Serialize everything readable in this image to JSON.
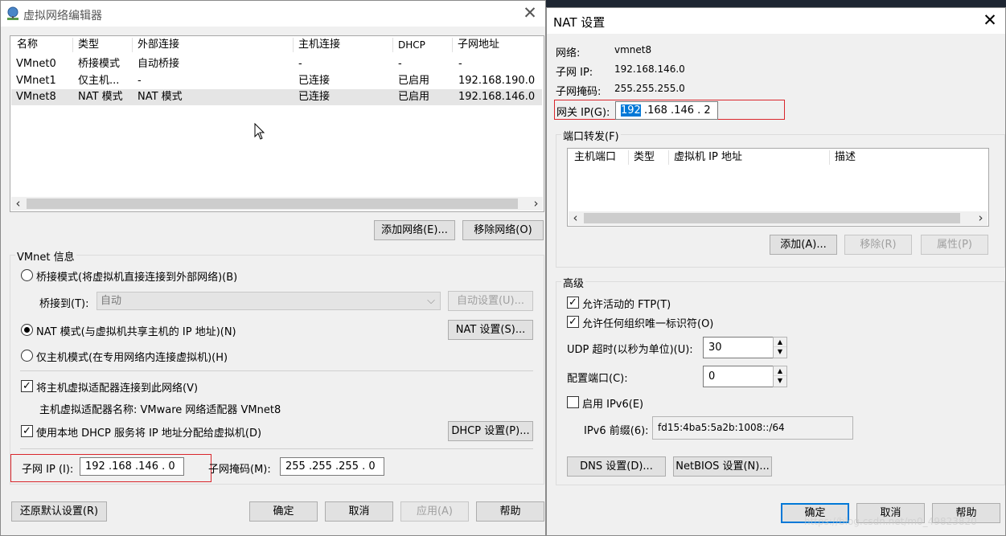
{
  "left_window": {
    "title": "虚拟网络编辑器",
    "columns": [
      "名称",
      "类型",
      "外部连接",
      "主机连接",
      "DHCP",
      "子网地址"
    ],
    "rows": [
      {
        "name": "VMnet0",
        "type": "桥接模式",
        "external": "自动桥接",
        "host": "-",
        "dhcp": "-",
        "subnet": "-"
      },
      {
        "name": "VMnet1",
        "type": "仅主机...",
        "external": "-",
        "host": "已连接",
        "dhcp": "已启用",
        "subnet": "192.168.190.0"
      },
      {
        "name": "VMnet8",
        "type": "NAT 模式",
        "external": "NAT 模式",
        "host": "已连接",
        "dhcp": "已启用",
        "subnet": "192.168.146.0"
      }
    ],
    "add_network": "添加网络(E)...",
    "remove_network": "移除网络(O)",
    "vmnet_info": "VMnet 信息",
    "bridge_mode": "桥接模式(将虚拟机直接连接到外部网络)(B)",
    "bridge_to_label": "桥接到(T):",
    "bridge_to_value": "自动",
    "auto_settings": "自动设置(U)...",
    "nat_mode": "NAT 模式(与虚拟机共享主机的 IP 地址)(N)",
    "nat_settings": "NAT 设置(S)...",
    "host_only": "仅主机模式(在专用网络内连接虚拟机)(H)",
    "connect_adapter": "将主机虚拟适配器连接到此网络(V)",
    "adapter_name": "主机虚拟适配器名称: VMware 网络适配器 VMnet8",
    "use_dhcp": "使用本地 DHCP 服务将 IP 地址分配给虚拟机(D)",
    "dhcp_settings": "DHCP 设置(P)...",
    "subnet_ip_label": "子网 IP (I):",
    "subnet_ip": "192 .168 .146 .  0",
    "subnet_mask_label": "子网掩码(M):",
    "subnet_mask": "255 .255 .255 .  0",
    "restore_defaults": "还原默认设置(R)",
    "ok": "确定",
    "cancel": "取消",
    "apply": "应用(A)",
    "help": "帮助"
  },
  "right_window": {
    "title": "NAT 设置",
    "network_label": "网络:",
    "network_value": "vmnet8",
    "subnet_ip_label": "子网 IP:",
    "subnet_ip_value": "192.168.146.0",
    "subnet_mask_label": "子网掩码:",
    "subnet_mask_value": "255.255.255.0",
    "gateway_label": "网关 IP(G):",
    "gateway_selected": "192",
    "gateway_rest": " .168 .146 .  2",
    "port_forwarding": "端口转发(F)",
    "pf_columns": [
      "主机端口",
      "类型",
      "虚拟机 IP 地址",
      "描述"
    ],
    "add": "添加(A)...",
    "remove": "移除(R)",
    "properties": "属性(P)",
    "advanced": "高级",
    "allow_ftp": "允许活动的 FTP(T)",
    "allow_oui": "允许任何组织唯一标识符(O)",
    "udp_timeout_label": "UDP 超时(以秒为单位)(U):",
    "udp_timeout": "30",
    "config_port_label": "配置端口(C):",
    "config_port": "0",
    "enable_ipv6": "启用 IPv6(E)",
    "ipv6_prefix_label": "IPv6 前缀(6):",
    "ipv6_prefix": "fd15:4ba5:5a2b:1008::/64",
    "dns_settings": "DNS 设置(D)...",
    "netbios_settings": "NetBIOS 设置(N)...",
    "ok": "确定",
    "cancel": "取消",
    "help": "帮助",
    "watermark": "https://blog.csdn.net/m0_49823820"
  }
}
